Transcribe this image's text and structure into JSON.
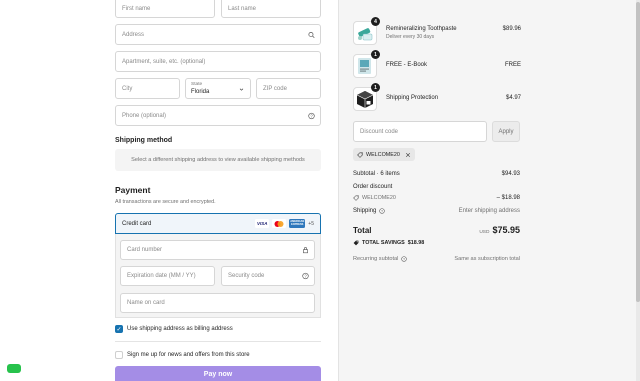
{
  "address_form": {
    "first_name_placeholder": "First name",
    "last_name_placeholder": "Last name",
    "address_placeholder": "Address",
    "apartment_placeholder": "Apartment, suite, etc. (optional)",
    "city_placeholder": "City",
    "state_label": "State",
    "state_value": "Florida",
    "zip_placeholder": "ZIP code",
    "phone_placeholder": "Phone (optional)"
  },
  "shipping_method": {
    "title": "Shipping method",
    "message": "Select a different shipping address to view available shipping methods"
  },
  "payment": {
    "title": "Payment",
    "subtitle": "All transactions are secure and encrypted.",
    "credit_card_label": "Credit card",
    "card_brands": [
      "VISA",
      "mastercard",
      "AMERICAN EXPRESS"
    ],
    "more_cards": "+5",
    "card_number_placeholder": "Card number",
    "expiration_placeholder": "Expiration date (MM / YY)",
    "security_code_placeholder": "Security code",
    "name_on_card_placeholder": "Name on card",
    "billing_same_label": "Use shipping address as billing address",
    "billing_same_checked": true,
    "newsletter_label": "Sign me up for news and offers from this store",
    "newsletter_checked": false,
    "pay_button": "Pay now"
  },
  "order_summary": {
    "items": [
      {
        "name": "Remineralizing Toothpaste",
        "subtitle": "Deliver every 30 days",
        "price": "$89.96",
        "quantity": "4",
        "icon": "toothpaste-icon"
      },
      {
        "name": "FREE - E-Book",
        "subtitle": "",
        "price": "FREE",
        "quantity": "1",
        "icon": "ebook-icon"
      },
      {
        "name": "Shipping Protection",
        "subtitle": "",
        "price": "$4.97",
        "quantity": "1",
        "icon": "package-icon"
      }
    ],
    "discount_placeholder": "Discount code",
    "apply_label": "Apply",
    "applied_code": "WELCOME20",
    "subtotal_label": "Subtotal · 6 items",
    "subtotal_value": "$94.93",
    "order_discount_label": "Order discount",
    "discount_code_label": "WELCOME20",
    "discount_value": "– $18.98",
    "shipping_label": "Shipping",
    "shipping_value": "Enter shipping address",
    "total_label": "Total",
    "currency": "USD",
    "total_value": "$75.95",
    "savings_label": "TOTAL SAVINGS",
    "savings_value": "$18.98",
    "recurring_label": "Recurring subtotal",
    "recurring_value": "Same as subscription total"
  },
  "colors": {
    "accent": "#1773b0",
    "pay_button": "#a48de6",
    "summary_bg": "#f5f5f5"
  }
}
